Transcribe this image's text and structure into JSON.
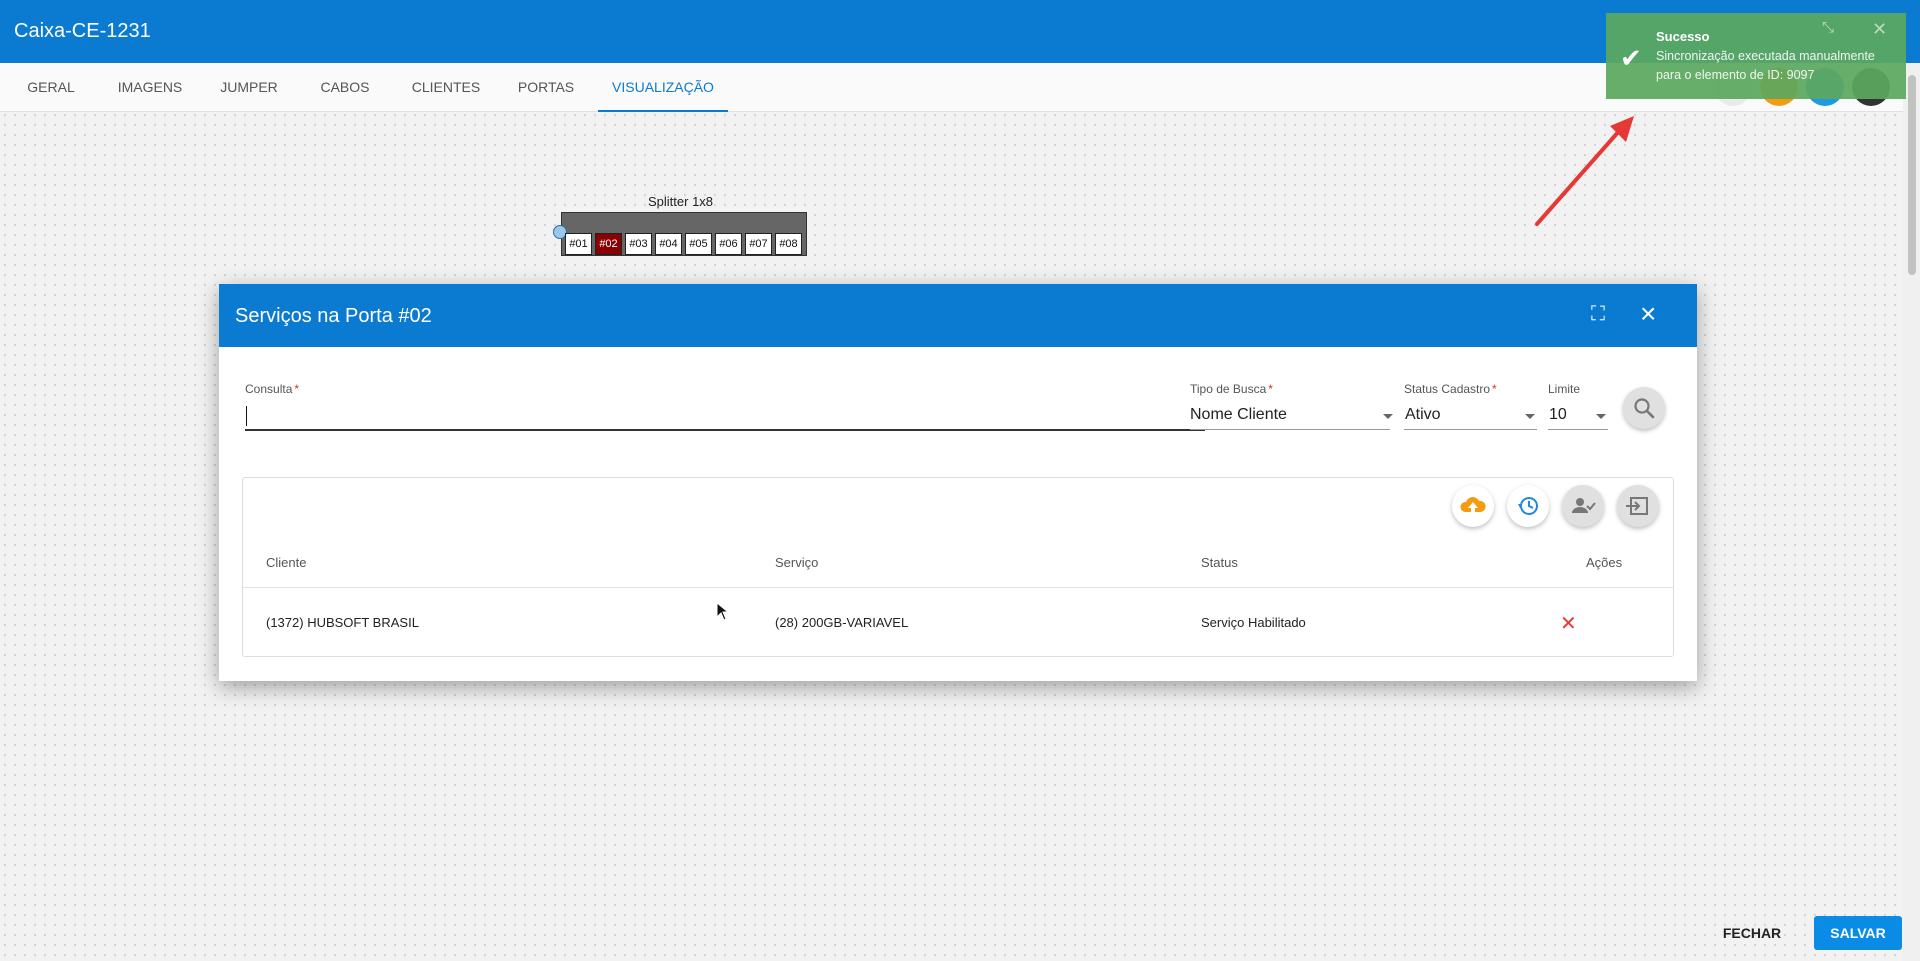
{
  "header": {
    "title": "Caixa-CE-1231"
  },
  "tabs": [
    {
      "label": "GERAL"
    },
    {
      "label": "IMAGENS"
    },
    {
      "label": "JUMPER"
    },
    {
      "label": "CABOS"
    },
    {
      "label": "CLIENTES"
    },
    {
      "label": "PORTAS"
    },
    {
      "label": "VISUALIZAÇÃO"
    }
  ],
  "active_tab": "VISUALIZAÇÃO",
  "splitter": {
    "title": "Splitter 1x8",
    "ports": [
      "#01",
      "#02",
      "#03",
      "#04",
      "#05",
      "#06",
      "#07",
      "#08"
    ],
    "selected_port": "#02"
  },
  "toast": {
    "title": "Sucesso",
    "message": "Sincronização executada manualmente para o elemento de ID: 9097",
    "icon": "check-icon"
  },
  "dialog": {
    "title": "Serviços na Porta #02",
    "fields": {
      "consulta": {
        "label": "Consulta",
        "value": ""
      },
      "tipo_busca": {
        "label": "Tipo de Busca",
        "value": "Nome Cliente"
      },
      "status_cadastro": {
        "label": "Status Cadastro",
        "value": "Ativo"
      },
      "limite": {
        "label": "Limite",
        "value": "10"
      }
    },
    "table": {
      "columns": [
        "Cliente",
        "Serviço",
        "Status",
        "Ações"
      ],
      "rows": [
        {
          "cliente": "(1372) HUBSOFT BRASIL",
          "servico": "(28) 200GB-VARIAVEL",
          "status": "Serviço Habilitado"
        }
      ],
      "toolbar_icons": [
        "cloud-upload-icon",
        "history-icon",
        "person-check-icon",
        "input-icon"
      ]
    }
  },
  "footer": {
    "close_label": "FECHAR",
    "save_label": "SALVAR"
  },
  "colors": {
    "primary": "#0a7bd0",
    "toast_success": "#5ca860",
    "selected_port": "#8b0000",
    "remove": "#e53935",
    "upload": "#f39c12",
    "arrow": "#e53935"
  }
}
